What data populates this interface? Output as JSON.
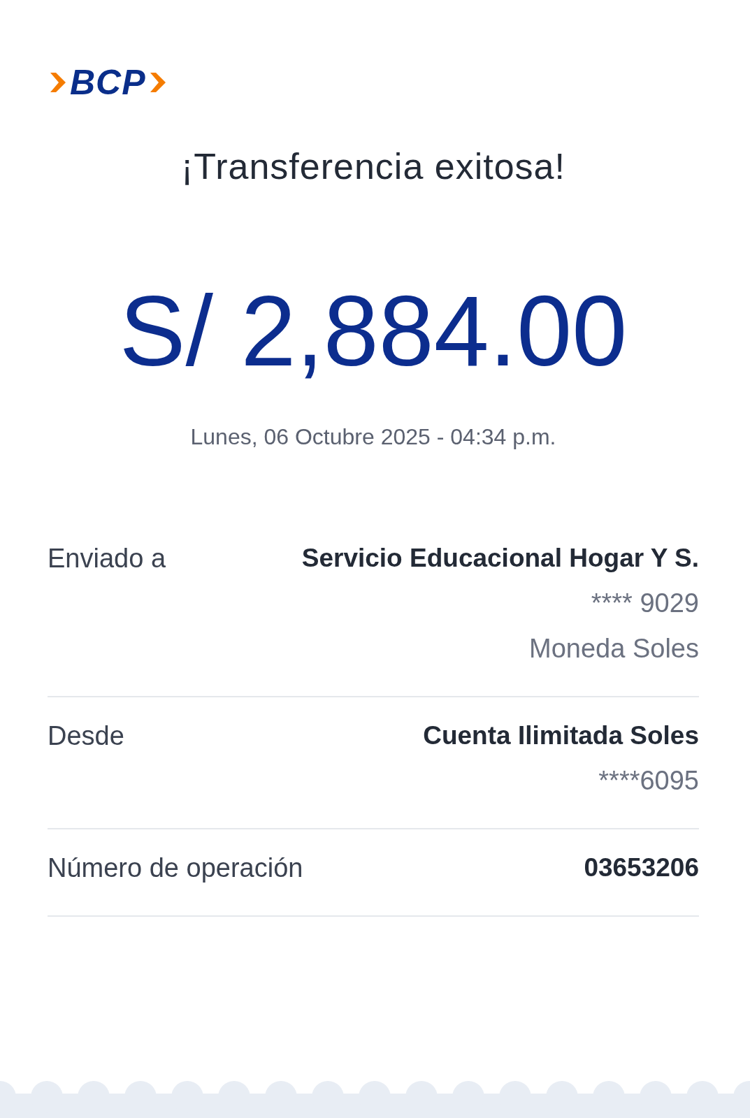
{
  "logo": {
    "text": "BCP"
  },
  "title": "¡Transferencia exitosa!",
  "amount": "S/ 2,884.00",
  "datetime": "Lunes, 06 Octubre 2025 - 04:34 p.m.",
  "details": [
    {
      "label": "Enviado a",
      "value": "Servicio Educacional Hogar Y S.",
      "extra": [
        "**** 9029",
        "Moneda Soles"
      ]
    },
    {
      "label": "Desde",
      "value": "Cuenta Ilimitada Soles",
      "extra": [
        "****6095"
      ]
    },
    {
      "label": "Número de operación",
      "value": "03653206"
    }
  ]
}
